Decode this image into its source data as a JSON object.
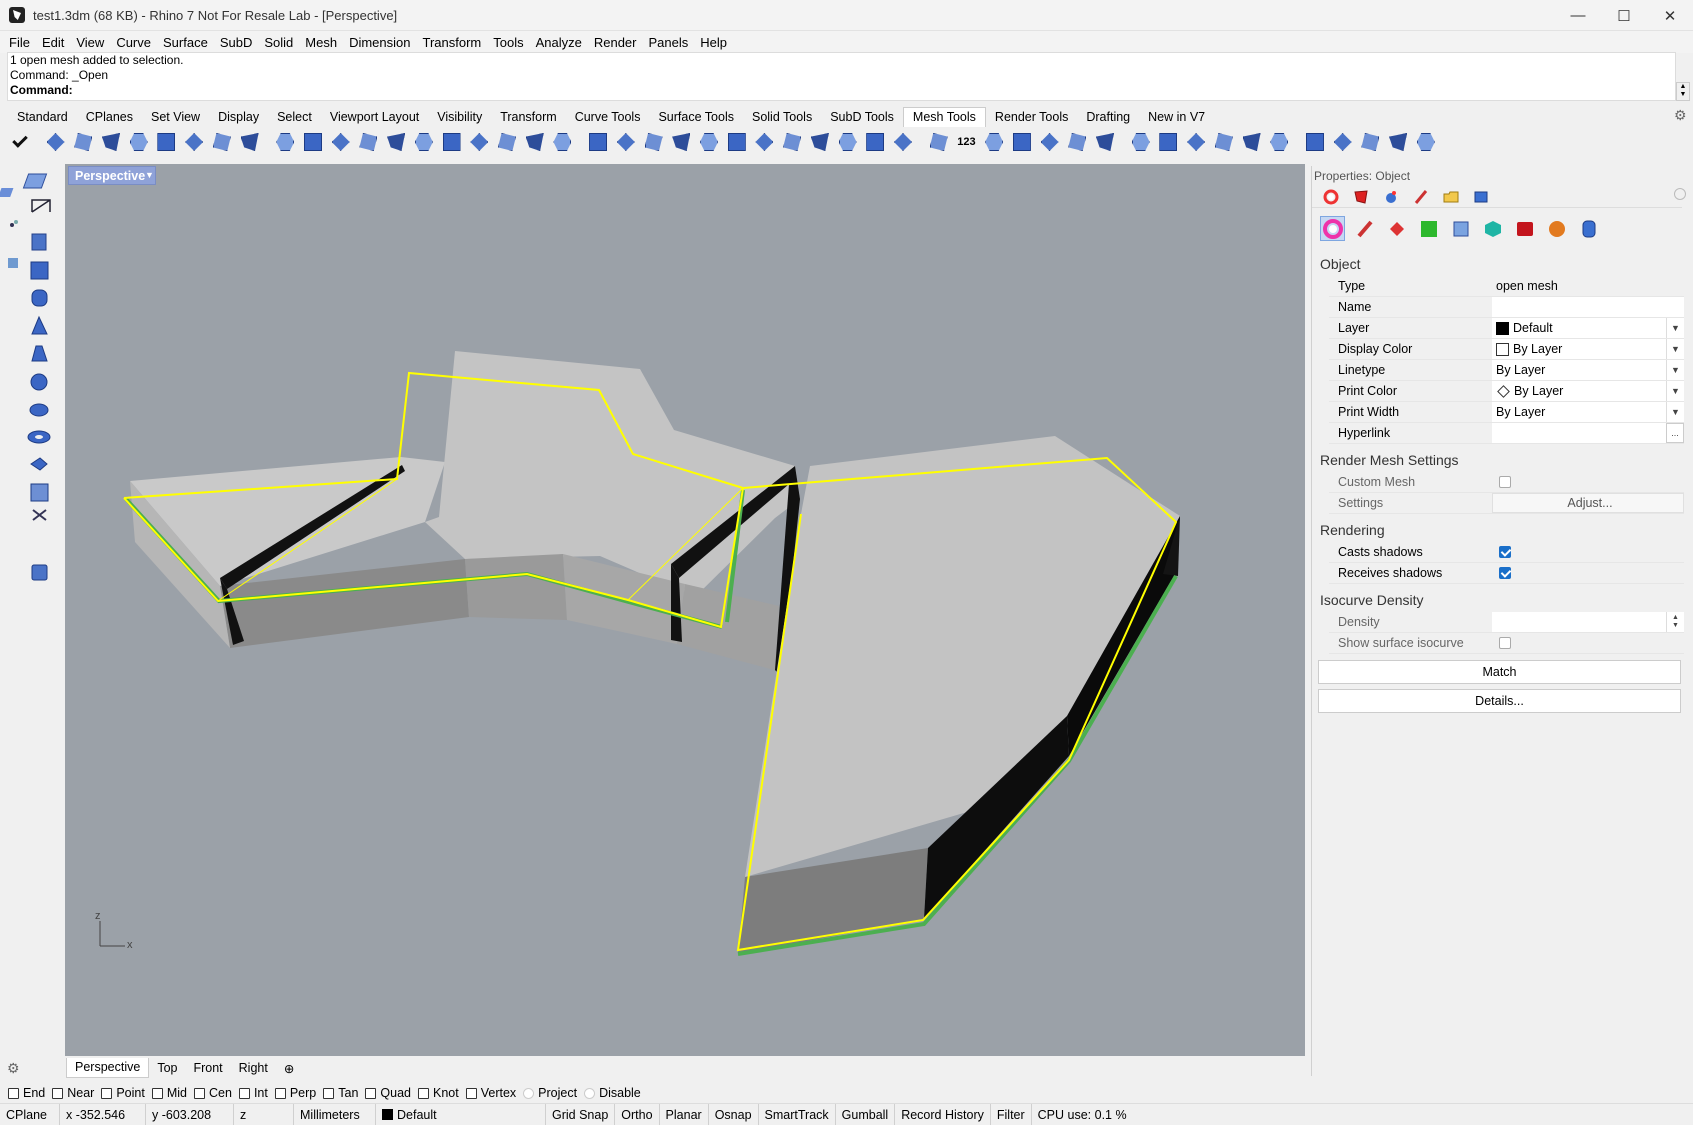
{
  "window": {
    "title": "test1.3dm (68 KB) - Rhino 7 Not For Resale Lab - [Perspective]",
    "minimize": "—",
    "maximize": "☐",
    "close": "✕"
  },
  "menu": [
    "File",
    "Edit",
    "View",
    "Curve",
    "Surface",
    "SubD",
    "Solid",
    "Mesh",
    "Dimension",
    "Transform",
    "Tools",
    "Analyze",
    "Render",
    "Panels",
    "Help"
  ],
  "command": {
    "history_line1": "1 open mesh added to selection.",
    "history_line2": "Command: _Open",
    "prompt": "Command:"
  },
  "tool_tabs": [
    "Standard",
    "CPlanes",
    "Set View",
    "Display",
    "Select",
    "Viewport Layout",
    "Visibility",
    "Transform",
    "Curve Tools",
    "Surface Tools",
    "Solid Tools",
    "SubD Tools",
    "Mesh Tools",
    "Render Tools",
    "Drafting",
    "New in V7"
  ],
  "active_tool_tab": "Mesh Tools",
  "toolbar_icons": [
    "check-icon",
    "mesh-tool-icon",
    "mesh-box-icon",
    "mesh-plane-icon",
    "mesh-patch-icon",
    "figure-icon",
    "figure-2-icon",
    "figure-3-icon",
    "figure-4-icon",
    "cup-icon",
    "mesh-weld-icon",
    "skull-icon",
    "mesh-reduce-icon",
    "mesh-split-icon",
    "mesh-trim-icon",
    "mesh-offset-icon",
    "mesh-repair-icon",
    "mesh-fill-icon",
    "mesh-join-icon",
    "mesh-extract-icon",
    "mesh-boolean-icon",
    "mesh-union-icon",
    "mesh-diff-icon",
    "mesh-intersect-icon",
    "mesh-cube-icon",
    "mesh-flatten-icon",
    "mesh-unweld-icon",
    "mesh-ribbon-icon",
    "mesh-outline-icon",
    "mesh-quad-icon",
    "mesh-grid-icon",
    "mesh-grid-2-icon",
    "mesh-grid-3-icon",
    "number-123-icon",
    "mesh-vertex-icon",
    "mesh-edge-icon",
    "mesh-point-icon",
    "mesh-hex-icon",
    "mesh-hex-2-icon",
    "mesh-slice-icon",
    "mesh-export-icon",
    "mesh-export-2-icon",
    "mesh-cage-icon",
    "mesh-sphere-icon",
    "mesh-sphere-2-icon",
    "mesh-shell-icon",
    "mesh-box-3-icon",
    "mesh-display-icon",
    "mesh-grid-4-icon",
    "mesh-cage-2-icon"
  ],
  "viewport": {
    "active_name": "Perspective",
    "axis_z": "z",
    "axis_x": "x"
  },
  "viewport_tabs": [
    "Perspective",
    "Top",
    "Front",
    "Right"
  ],
  "viewport_tab_add": "⊕",
  "osnap": [
    {
      "label": "End",
      "checked": false
    },
    {
      "label": "Near",
      "checked": false
    },
    {
      "label": "Point",
      "checked": false
    },
    {
      "label": "Mid",
      "checked": false
    },
    {
      "label": "Cen",
      "checked": false
    },
    {
      "label": "Int",
      "checked": false
    },
    {
      "label": "Perp",
      "checked": false
    },
    {
      "label": "Tan",
      "checked": false
    },
    {
      "label": "Quad",
      "checked": false
    },
    {
      "label": "Knot",
      "checked": false
    },
    {
      "label": "Vertex",
      "checked": false
    },
    {
      "label": "Project",
      "checked": false
    },
    {
      "label": "Disable",
      "checked": false
    }
  ],
  "status": {
    "cplane": "CPlane",
    "x": "x -352.546",
    "y": "y -603.208",
    "z": "z",
    "units": "Millimeters",
    "layer": "Default",
    "grid_snap": "Grid Snap",
    "ortho": "Ortho",
    "planar": "Planar",
    "osnap": "Osnap",
    "smarttrack": "SmartTrack",
    "gumball": "Gumball",
    "record_history": "Record History",
    "filter": "Filter",
    "cpu": "CPU use: 0.1 %"
  },
  "properties": {
    "panel_title": "Properties: Object",
    "section_object": "Object",
    "type_label": "Type",
    "type_value": "open mesh",
    "name_label": "Name",
    "name_value": "",
    "layer_label": "Layer",
    "layer_value": "Default",
    "display_color_label": "Display Color",
    "display_color_value": "By Layer",
    "linetype_label": "Linetype",
    "linetype_value": "By Layer",
    "print_color_label": "Print Color",
    "print_color_value": "By Layer",
    "print_width_label": "Print Width",
    "print_width_value": "By Layer",
    "hyperlink_label": "Hyperlink",
    "hyperlink_button": "...",
    "section_render_mesh": "Render Mesh Settings",
    "custom_mesh_label": "Custom Mesh",
    "settings_label": "Settings",
    "adjust_button": "Adjust...",
    "section_rendering": "Rendering",
    "casts_shadows_label": "Casts shadows",
    "receives_shadows_label": "Receives shadows",
    "section_isocurve": "Isocurve Density",
    "density_label": "Density",
    "show_isocurve_label": "Show surface isocurve",
    "match_button": "Match",
    "details_button": "Details..."
  },
  "colors": {
    "viewport_bg": "#9ba1a8",
    "selection_yellow": "#ffff00",
    "edge_green": "#4caf50",
    "viewport_tab_active": "#8fa2d8"
  }
}
